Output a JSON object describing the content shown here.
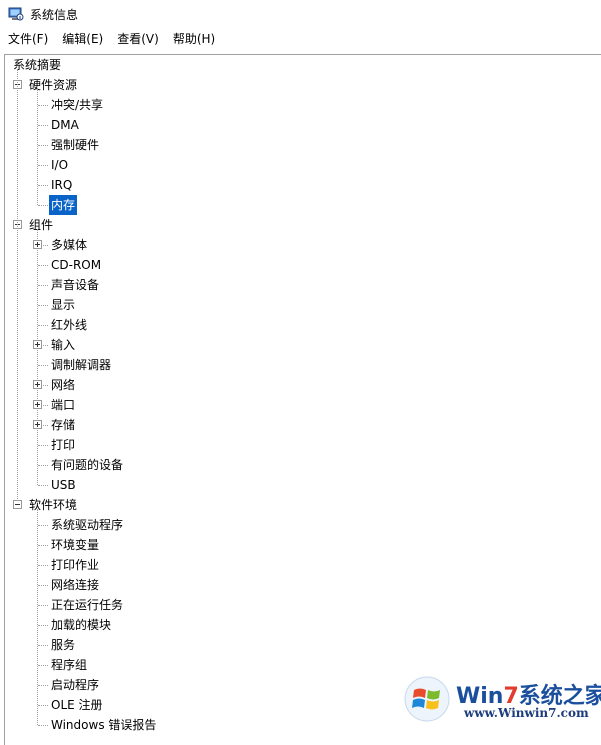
{
  "window": {
    "title": "系统信息"
  },
  "menu": [
    {
      "label": "文件(F)"
    },
    {
      "label": "编辑(E)"
    },
    {
      "label": "查看(V)"
    },
    {
      "label": "帮助(H)"
    }
  ],
  "tree": {
    "root": "系统摘要",
    "hardware": {
      "label": "硬件资源",
      "items": [
        "冲突/共享",
        "DMA",
        "强制硬件",
        "I/O",
        "IRQ",
        "内存"
      ],
      "selected": "内存"
    },
    "components": {
      "label": "组件",
      "items": [
        {
          "label": "多媒体",
          "expandable": true
        },
        {
          "label": "CD-ROM",
          "expandable": false
        },
        {
          "label": "声音设备",
          "expandable": false
        },
        {
          "label": "显示",
          "expandable": false
        },
        {
          "label": "红外线",
          "expandable": false
        },
        {
          "label": "输入",
          "expandable": true
        },
        {
          "label": "调制解调器",
          "expandable": false
        },
        {
          "label": "网络",
          "expandable": true
        },
        {
          "label": "端口",
          "expandable": true
        },
        {
          "label": "存储",
          "expandable": true
        },
        {
          "label": "打印",
          "expandable": false
        },
        {
          "label": "有问题的设备",
          "expandable": false
        },
        {
          "label": "USB",
          "expandable": false
        }
      ]
    },
    "software": {
      "label": "软件环境",
      "items": [
        "系统驱动程序",
        "环境变量",
        "打印作业",
        "网络连接",
        "正在运行任务",
        "加载的模块",
        "服务",
        "程序组",
        "启动程序",
        "OLE 注册",
        "Windows 错误报告"
      ]
    }
  },
  "watermark": {
    "brand_prefix": "Win",
    "brand_seven": "7",
    "brand_suffix": "系统之家",
    "url": "www.Winwin7.com",
    "colors": {
      "blue": "#1b4f9e",
      "red": "#e33b2f"
    }
  },
  "colors": {
    "selection": "#0a64c8",
    "tree_lines": "#a0a0a0"
  }
}
